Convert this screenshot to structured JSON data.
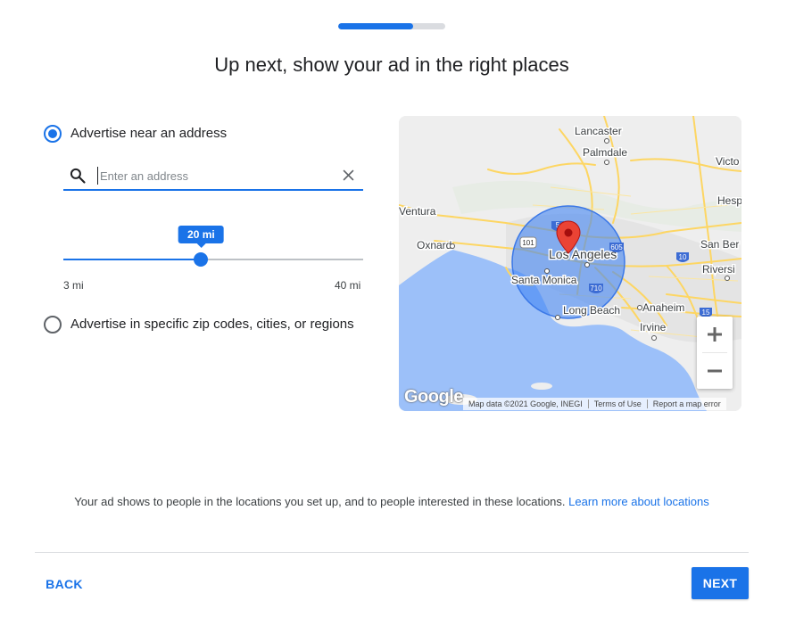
{
  "progress": {
    "fraction": 0.7
  },
  "page_title": "Up next, show your ad in the right places",
  "options": {
    "near_address": {
      "label": "Advertise near an address",
      "selected": true
    },
    "specific_regions": {
      "label": "Advertise in specific zip codes, cities, or regions",
      "selected": false
    }
  },
  "search": {
    "placeholder": "Enter an address",
    "value": ""
  },
  "radius_slider": {
    "min_value": 3,
    "max_value": 40,
    "current_value": 20,
    "min_label": "3 mi",
    "max_label": "40 mi",
    "tooltip": "20 mi"
  },
  "map": {
    "places": [
      "Lancaster",
      "Palmdale",
      "Victo",
      "Hesp",
      "Ventura",
      "Oxnard",
      "San Ber",
      "Los Angeles",
      "Riversi",
      "Santa Monica",
      "Long Beach",
      "Anaheim",
      "Irvine"
    ],
    "highways": [
      "101",
      "5",
      "10",
      "605",
      "710",
      "15"
    ],
    "attribution": {
      "map_data": "Map data ©2021 Google, INEGI",
      "terms": "Terms of Use",
      "report": "Report a map error"
    },
    "logo": "Google",
    "colors": {
      "land": "#eeeeee",
      "water": "#9cc0f9",
      "road": "#fdd663",
      "radius_fill": "#4285f4",
      "pin": "#ea4335"
    }
  },
  "icons": {
    "search": "search-icon",
    "clear": "close-icon",
    "zoom_in": "plus-icon",
    "zoom_out": "minus-icon",
    "pin": "map-pin-icon"
  },
  "footer": {
    "info_text": "Your ad shows to people in the locations you set up, and to people interested in these locations.",
    "learn_more": "Learn more about locations",
    "back_label": "BACK",
    "next_label": "NEXT"
  },
  "colors": {
    "accent": "#1a73e8",
    "track": "#bdc1c6"
  }
}
